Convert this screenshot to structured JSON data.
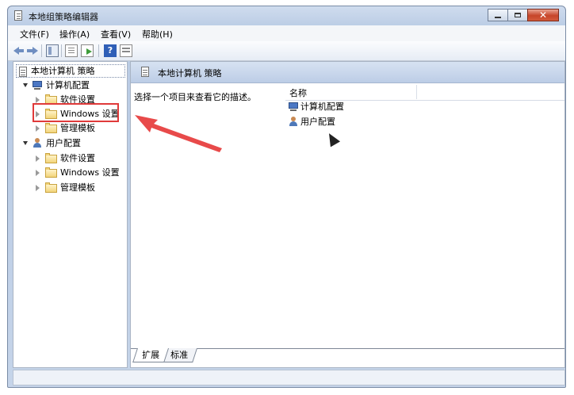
{
  "window": {
    "title": "本地组策略编辑器",
    "close_glyph": "✕"
  },
  "menu": [
    "文件(F)",
    "操作(A)",
    "查看(V)",
    "帮助(H)"
  ],
  "toolbar": {
    "help_glyph": "?"
  },
  "tree": {
    "root": "本地计算机 策略",
    "computer": {
      "label": "计算机配置",
      "children": [
        "软件设置",
        "Windows 设置",
        "管理模板"
      ]
    },
    "user": {
      "label": "用户配置",
      "children": [
        "软件设置",
        "Windows 设置",
        "管理模板"
      ]
    }
  },
  "right": {
    "header": "本地计算机 策略",
    "description": "选择一个项目来查看它的描述。",
    "column_name": "名称",
    "items": [
      "计算机配置",
      "用户配置"
    ]
  },
  "tabs": [
    "扩展",
    "标准"
  ],
  "colors": {
    "highlight_box": "#e03a3a",
    "annotation_arrow": "#e84a4a"
  }
}
